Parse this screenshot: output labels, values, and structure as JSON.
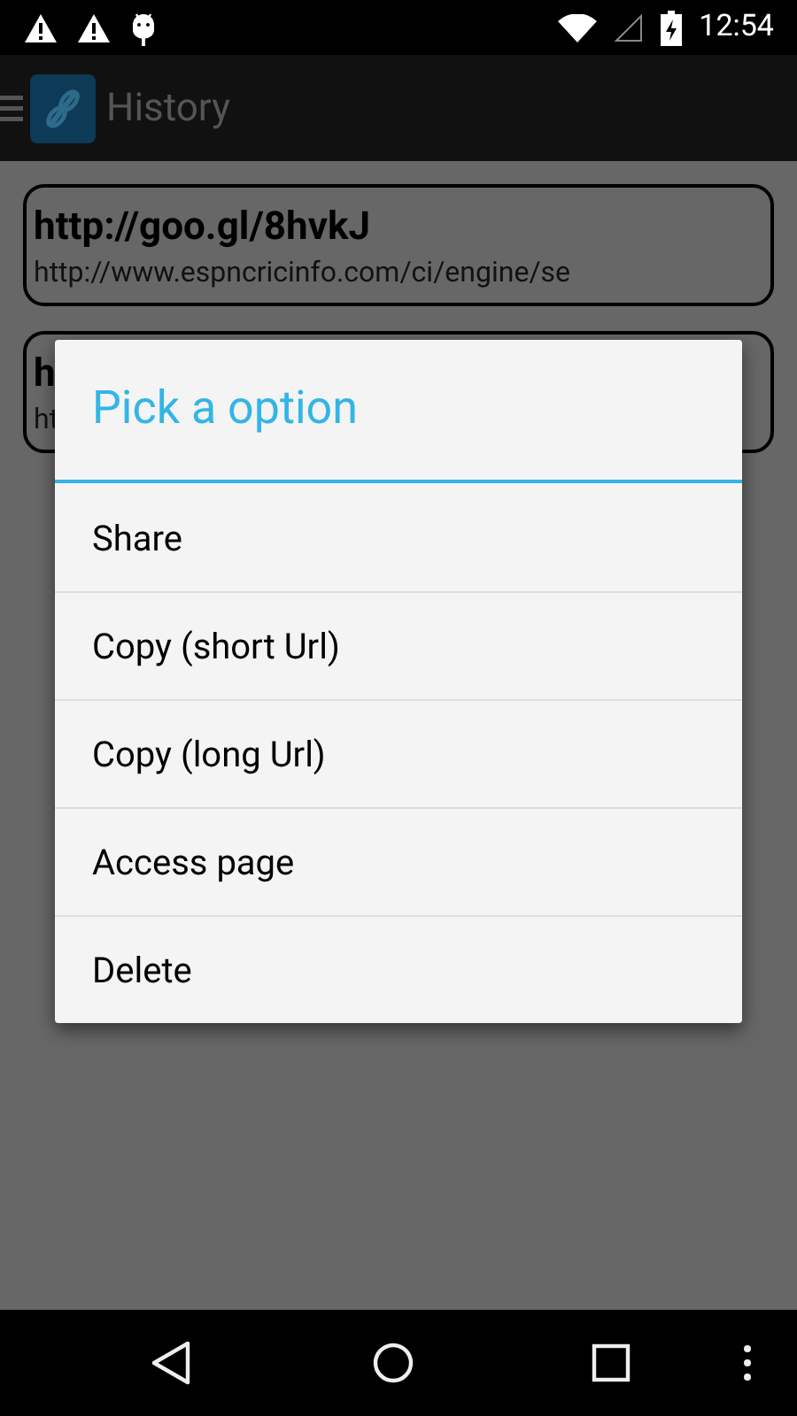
{
  "status_bar": {
    "time": "12:54"
  },
  "app_bar": {
    "title": "History"
  },
  "history": [
    {
      "short_url": "http://goo.gl/8hvkJ",
      "long_url": "http://www.espncricinfo.com/ci/engine/se"
    },
    {
      "short_url": "h",
      "long_url": "ht"
    }
  ],
  "dialog": {
    "title": "Pick a option",
    "options": [
      "Share",
      "Copy (short Url)",
      "Copy (long Url)",
      "Access page",
      "Delete"
    ]
  }
}
